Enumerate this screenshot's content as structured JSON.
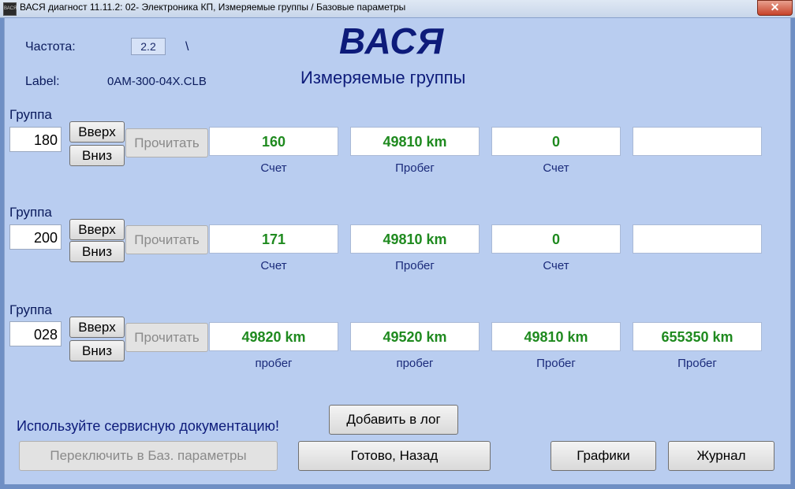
{
  "window": {
    "title": "ВАСЯ диагност 11.11.2: 02- Электроника КП,  Измеряемые группы / Базовые параметры",
    "close_label": "✕",
    "icon_text": "ВАСЯ"
  },
  "header": {
    "freq_label": "Частота:",
    "freq_value": "2.2",
    "freq_extra": "\\",
    "label_label": "Label:",
    "label_value": "0AM-300-04X.CLB",
    "logo": "ВАСЯ",
    "subtitle": "Измеряемые группы"
  },
  "groups": [
    {
      "label": "Группа",
      "number": "180",
      "up": "Вверх",
      "down": "Вниз",
      "read": "Прочитать",
      "values": [
        "160",
        "49810 km",
        "0",
        ""
      ],
      "units": [
        "Счет",
        "Пробег",
        "Счет",
        ""
      ]
    },
    {
      "label": "Группа",
      "number": "200",
      "up": "Вверх",
      "down": "Вниз",
      "read": "Прочитать",
      "values": [
        "171",
        "49810 km",
        "0",
        ""
      ],
      "units": [
        "Счет",
        "Пробег",
        "Счет",
        ""
      ]
    },
    {
      "label": "Группа",
      "number": "028",
      "up": "Вверх",
      "down": "Вниз",
      "read": "Прочитать",
      "values": [
        "49820 km",
        "49520 km",
        "49810 km",
        "655350 km"
      ],
      "units": [
        "пробег",
        "пробег",
        "Пробег",
        "Пробег"
      ]
    }
  ],
  "footer": {
    "notice": "Используйте сервисную документацию!",
    "add_log": "Добавить в лог",
    "switch_basic": "Переключить в Баз. параметры",
    "done_back": "Готово, Назад",
    "graphs": "Графики",
    "journal": "Журнал"
  },
  "colors": {
    "background": "#b9cdf0",
    "value_text": "#1f8a1f",
    "label_text": "#0d1b7a"
  }
}
